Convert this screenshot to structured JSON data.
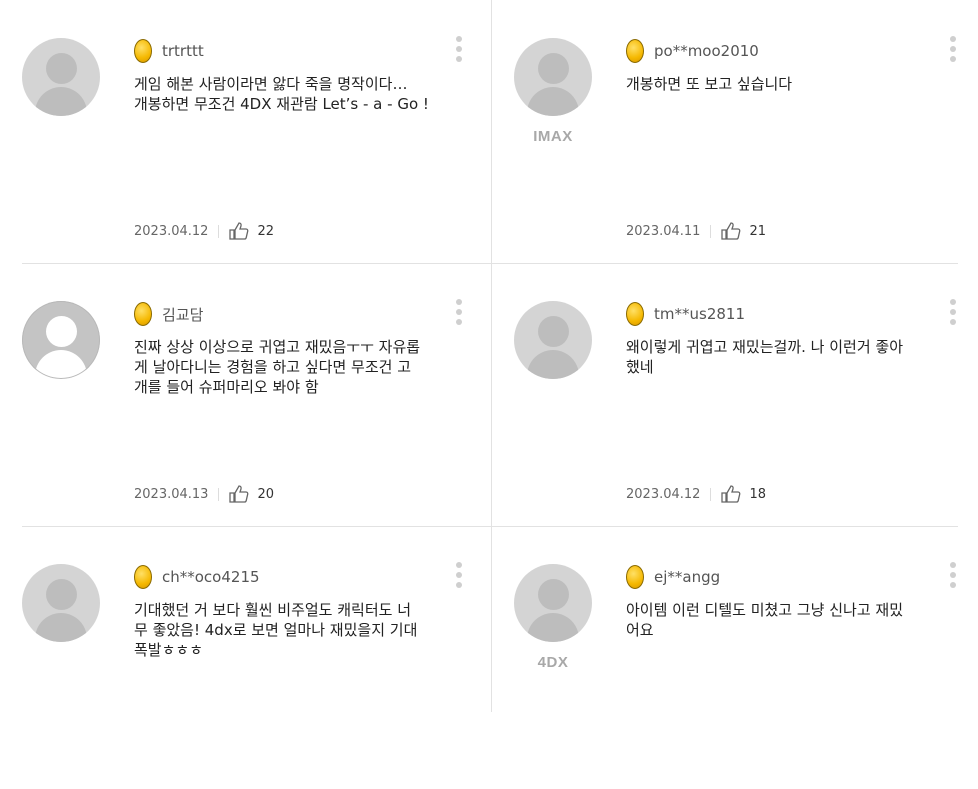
{
  "reviews": [
    {
      "username": "trtrttt",
      "comment": "게임 해본 사람이라면 앓다 죽을 명작이다…\n개봉하면 무조건 4DX 재관람 Let’s - a - Go !",
      "date": "2023.04.12",
      "likes": "22",
      "badge": "",
      "avatar_style": "default"
    },
    {
      "username": "po**moo2010",
      "comment": "개봉하면 또 보고 싶습니다",
      "date": "2023.04.11",
      "likes": "21",
      "badge": "IMAX",
      "avatar_style": "default"
    },
    {
      "username": "김교담",
      "comment": "진짜 상상 이상으로 귀엽고 재밌음ㅜㅜ 자유롭\n게 날아다니는 경험을 하고 싶다면 무조건 고\n개를 들어 슈퍼마리오 봐야 함",
      "date": "2023.04.13",
      "likes": "20",
      "badge": "",
      "avatar_style": "outline"
    },
    {
      "username": "tm**us2811",
      "comment": "왜이렇게 귀엽고 재밌는걸까. 나 이런거 좋아\n했네",
      "date": "2023.04.12",
      "likes": "18",
      "badge": "",
      "avatar_style": "default"
    },
    {
      "username": "ch**oco4215",
      "comment": "기대했던 거 보다 훨씬 비주얼도 캐릭터도 너\n무 좋았음! 4dx로 보면 얼마나 재밌을지 기대\n폭발ㅎㅎㅎ",
      "date": "",
      "likes": "",
      "badge": "",
      "avatar_style": "default"
    },
    {
      "username": "ej**angg",
      "comment": "아이템 이런 디텔도 미쳤고 그냥 신나고 재밌\n어요",
      "date": "",
      "likes": "",
      "badge": "4DX",
      "avatar_style": "default"
    }
  ],
  "icons": {
    "coin": "gold-coin-icon",
    "like": "thumbs-up-icon",
    "more": "more-vertical-icon"
  }
}
